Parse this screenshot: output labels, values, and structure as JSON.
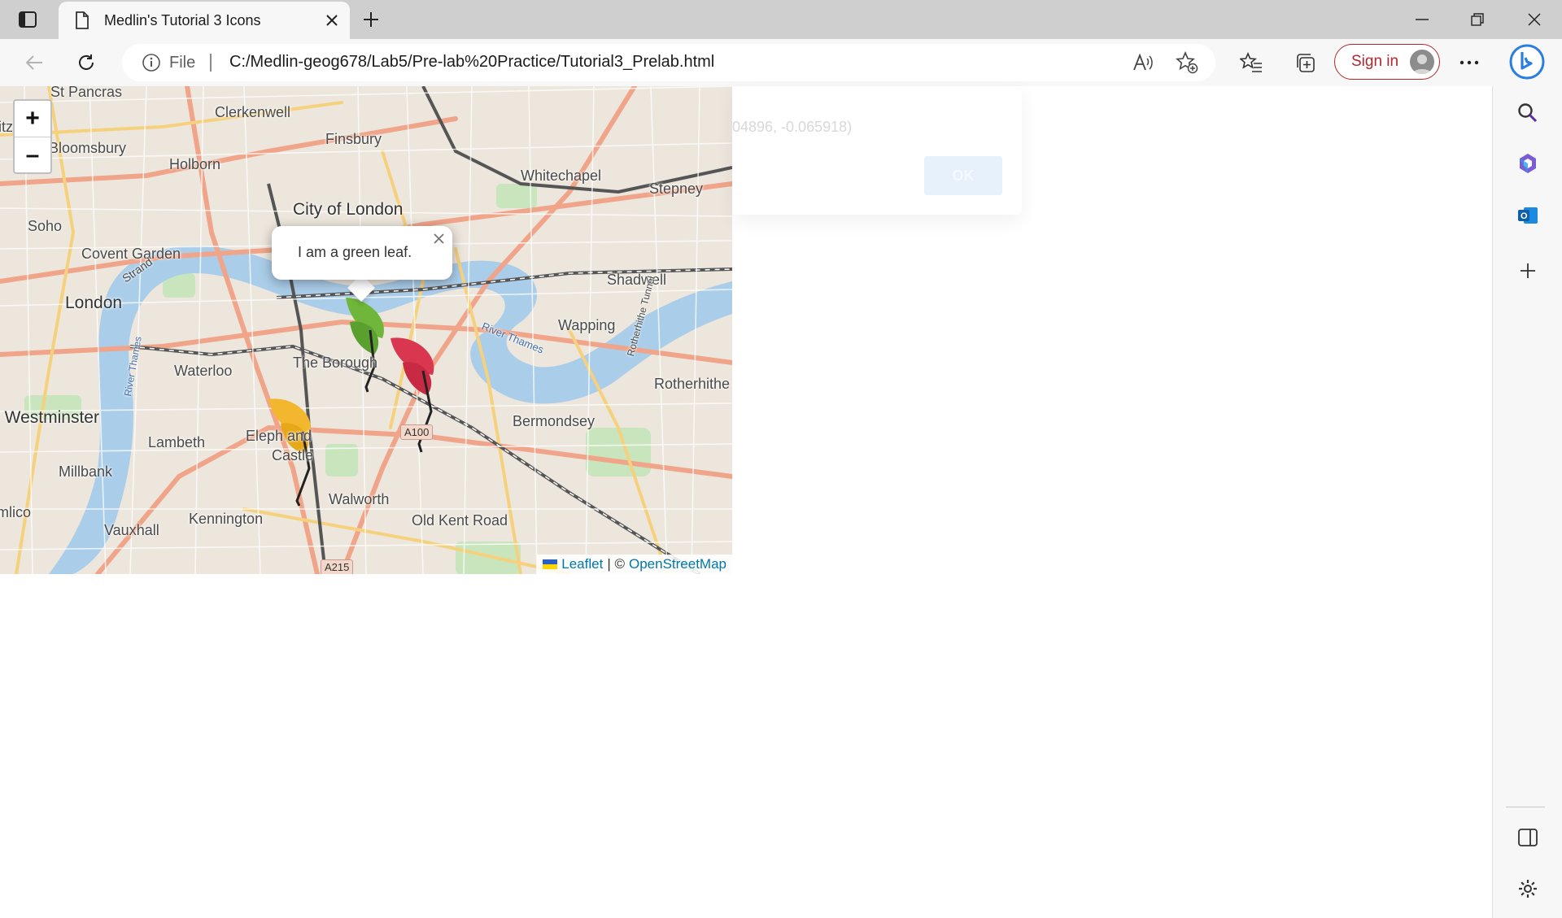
{
  "browser": {
    "tab": {
      "title": "Medlin's Tutorial 3 Icons"
    },
    "address": {
      "scheme_label": "File",
      "url": "C:/Medlin-geog678/Lab5/Pre-lab%20Practice/Tutorial3_Prelab.html"
    },
    "signin_label": "Sign in"
  },
  "map": {
    "zoom_in_label": "+",
    "zoom_out_label": "–",
    "places": {
      "st_pancras": "St Pancras",
      "clerkenwell": "Clerkenwell",
      "finsbury": "Finsbury",
      "whitechapel": "Whitechapel",
      "stepney": "Stepney",
      "bloomsbury": "Bloomsbury",
      "holborn": "Holborn",
      "city_of_london": "City of London",
      "soho": "Soho",
      "covent_garden": "Covent Garden",
      "strand": "Strand",
      "london": "London",
      "shadwell": "Shadwell",
      "wapping": "Wapping",
      "river_thames": "River Thames",
      "the_borough": "The Borough",
      "waterloo": "Waterloo",
      "rotherhithe": "Rotherhithe",
      "rotherhithe_tunnel": "Rotherhithe Tunnel",
      "westminster": "f Westminster",
      "lambeth": "Lambeth",
      "elephant_castle_1": "Eleph   and",
      "elephant_castle_2": "Castle",
      "bermondsey": "Bermondsey",
      "millbank": "Millbank",
      "walworth": "Walworth",
      "old_kent_road": "Old Kent Road",
      "kennington": "Kennington",
      "vauxhall": "Vauxhall",
      "pimlico": "mlico",
      "river_thames_2": "River Thames",
      "itz": "itz"
    },
    "roads": {
      "a100": "A100",
      "a215": "A215"
    },
    "popup_text": "I am a green leaf.",
    "attribution": {
      "leaflet": "Leaflet",
      "sep": "| ©",
      "osm": "OpenStreetMap"
    },
    "markers": [
      "green-leaf",
      "red-leaf",
      "orange-leaf"
    ]
  },
  "alert": {
    "message": "04896, -0.065918)",
    "ok_label": "OK"
  },
  "colors": {
    "accent_signin": "#b3262e",
    "link": "#0078a8",
    "river": "#a9cdea",
    "leaf_green": "#6fb63a",
    "leaf_red": "#d9364f",
    "leaf_orange": "#f2b72e"
  }
}
